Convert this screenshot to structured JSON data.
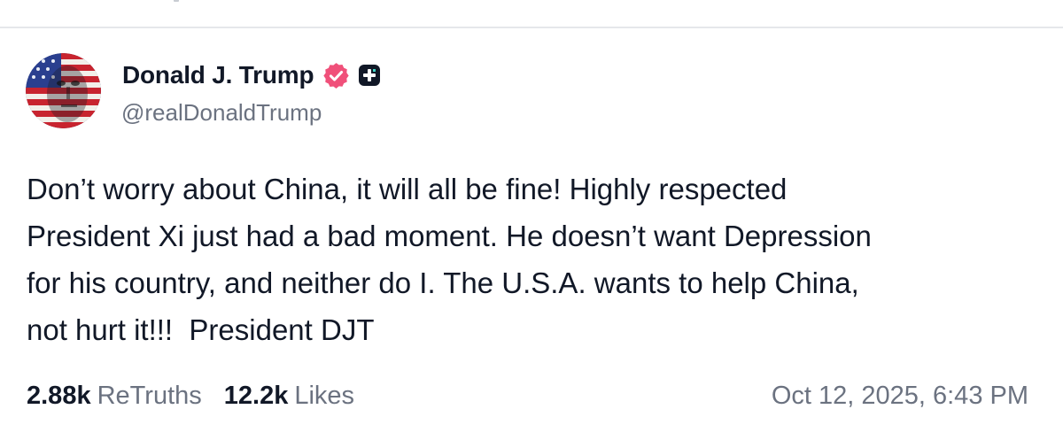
{
  "post": {
    "author": {
      "display_name": "Donald J. Trump",
      "handle": "@realDonaldTrump",
      "verified_icon": "verified-badge-icon",
      "plus_icon": "truth-plus-icon",
      "verified_color": "#f0507a"
    },
    "body": "Don’t worry about China, it will all be fine! Highly respected\nPresident Xi just had a bad moment. He doesn’t want Depression\nfor his country, and neither do I. The U.S.A. wants to help China,\nnot hurt it!!!  President DJT",
    "stats": {
      "retruths_count": "2.88k",
      "retruths_label": "ReTruths",
      "likes_count": "12.2k",
      "likes_label": "Likes"
    },
    "timestamp": "Oct 12, 2025, 6:43 PM"
  }
}
